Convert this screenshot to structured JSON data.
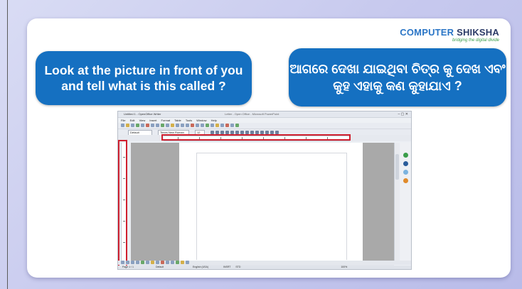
{
  "brand": {
    "name_part1": "COMPUTER",
    "name_part2": "SHIKSHA",
    "tagline": "bridging the digital divide"
  },
  "question_en": "Look at the picture in front of you and tell what is this called ?",
  "question_or": "ଆଗରେ ଦେଖା ଯାଇଥିବା ଚିତ୍ର କୁ ଦେଖ ଏବଂ କୁହ ଏହାକୁ କଣ କୁହାଯାଏ ?",
  "writer": {
    "window_title": "Untitled 1 - OpenOffice Writer",
    "center_title": "Letter - Open Office - Microsoft PowerPoint",
    "menu": [
      "File",
      "Edit",
      "View",
      "Insert",
      "Format",
      "Table",
      "Tools",
      "Window",
      "Help"
    ],
    "style_value": "Default",
    "font_value": "Times New Roman",
    "size_value": "12",
    "status_page": "Page 1 / 1",
    "status_style": "Default",
    "status_lang": "English (USA)",
    "status_mode": "INSRT",
    "status_std": "STD",
    "status_zoom": "100%"
  },
  "colors": {
    "bubble": "#1570c1",
    "highlight": "#d0202f",
    "brand_blue": "#2a75c6",
    "brand_dark": "#2b3a67",
    "tagline_green": "#3a9d4a"
  }
}
